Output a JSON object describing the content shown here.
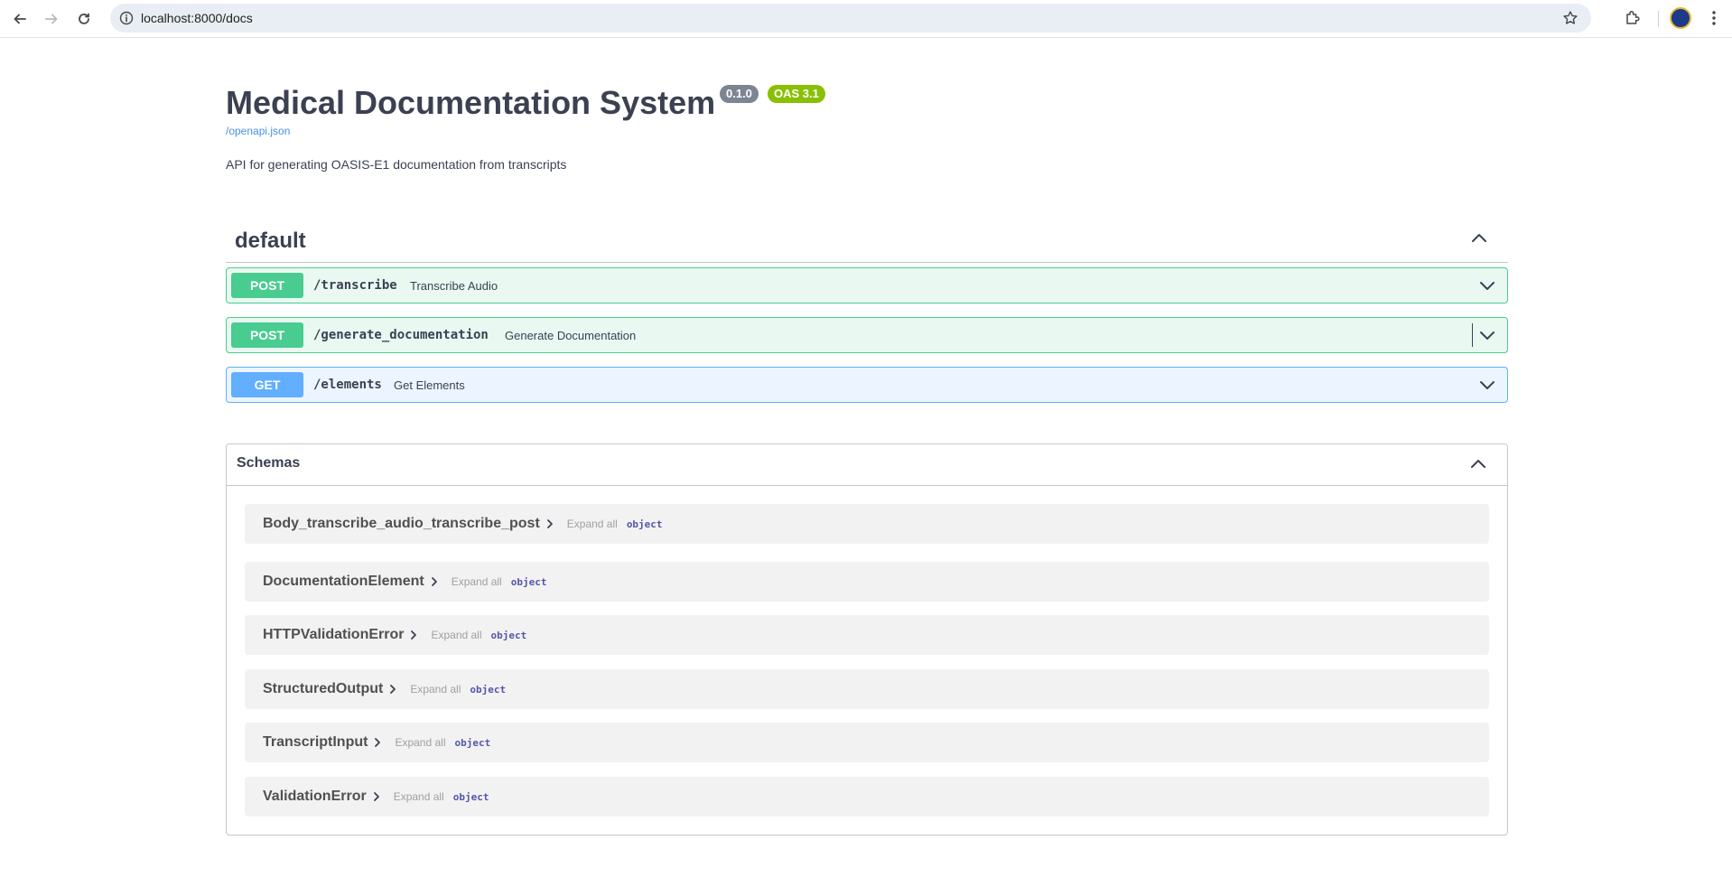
{
  "browser": {
    "url": "localhost:8000/docs"
  },
  "info": {
    "title": "Medical Documentation System",
    "version": "0.1.0",
    "oas": "OAS 3.1",
    "spec_link": "/openapi.json",
    "description": "API for generating OASIS-E1 documentation from transcripts"
  },
  "tag": {
    "name": "default"
  },
  "operations": [
    {
      "method": "POST",
      "path": "/transcribe",
      "summary": "Transcribe Audio"
    },
    {
      "method": "POST",
      "path": "/generate_documentation",
      "summary": "Generate Documentation"
    },
    {
      "method": "GET",
      "path": "/elements",
      "summary": "Get Elements"
    }
  ],
  "schemas": {
    "title": "Schemas",
    "models": [
      {
        "name": "Body_transcribe_audio_transcribe_post",
        "expand": "Expand all",
        "type": "object"
      },
      {
        "name": "DocumentationElement",
        "expand": "Expand all",
        "type": "object"
      },
      {
        "name": "HTTPValidationError",
        "expand": "Expand all",
        "type": "object"
      },
      {
        "name": "StructuredOutput",
        "expand": "Expand all",
        "type": "object"
      },
      {
        "name": "TranscriptInput",
        "expand": "Expand all",
        "type": "object"
      },
      {
        "name": "ValidationError",
        "expand": "Expand all",
        "type": "object"
      }
    ]
  },
  "colors": {
    "post": "#49cc90",
    "get": "#61affe",
    "version_badge": "#7d8492",
    "oas_badge": "#89bf04",
    "link": "#4990e2"
  },
  "icons": [
    "back-arrow-icon",
    "forward-arrow-icon",
    "reload-icon",
    "site-info-icon",
    "bookmark-star-icon",
    "extensions-icon",
    "profile-avatar",
    "browser-menu-icon",
    "chevron-up-icon",
    "chevron-down-icon",
    "chevron-right-icon"
  ]
}
